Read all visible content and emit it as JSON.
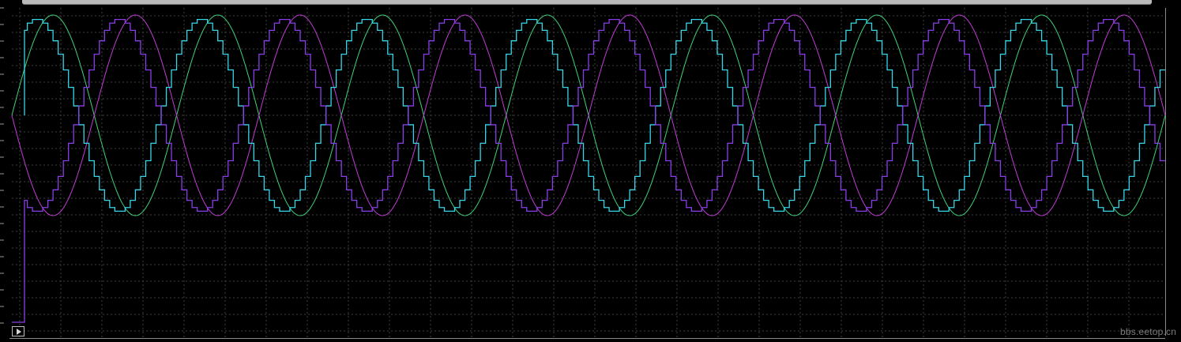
{
  "watermark": "bbs.eetop.cn",
  "controls": {
    "play_icon": "play-icon"
  },
  "colors": {
    "background": "#000000",
    "grid": "#3f3f3f",
    "sine_a": "#3fd17a",
    "sine_b": "#c13bd6",
    "staircase_a": "#37d6e8",
    "staircase_b": "#8a3ee8"
  },
  "chart_data": {
    "type": "line",
    "grid": true,
    "series": [
      {
        "kind": "sine",
        "phase": 0,
        "cycles": 7,
        "color_key": "sine_a"
      },
      {
        "kind": "sine",
        "phase": 180,
        "cycles": 7,
        "color_key": "sine_b"
      },
      {
        "kind": "staircase",
        "phase": 0,
        "cycles": 7,
        "steps_per_cycle": 32,
        "color_key": "staircase_a"
      },
      {
        "kind": "staircase",
        "phase": 180,
        "cycles": 7,
        "steps_per_cycle": 32,
        "color_key": "staircase_b"
      }
    ]
  }
}
